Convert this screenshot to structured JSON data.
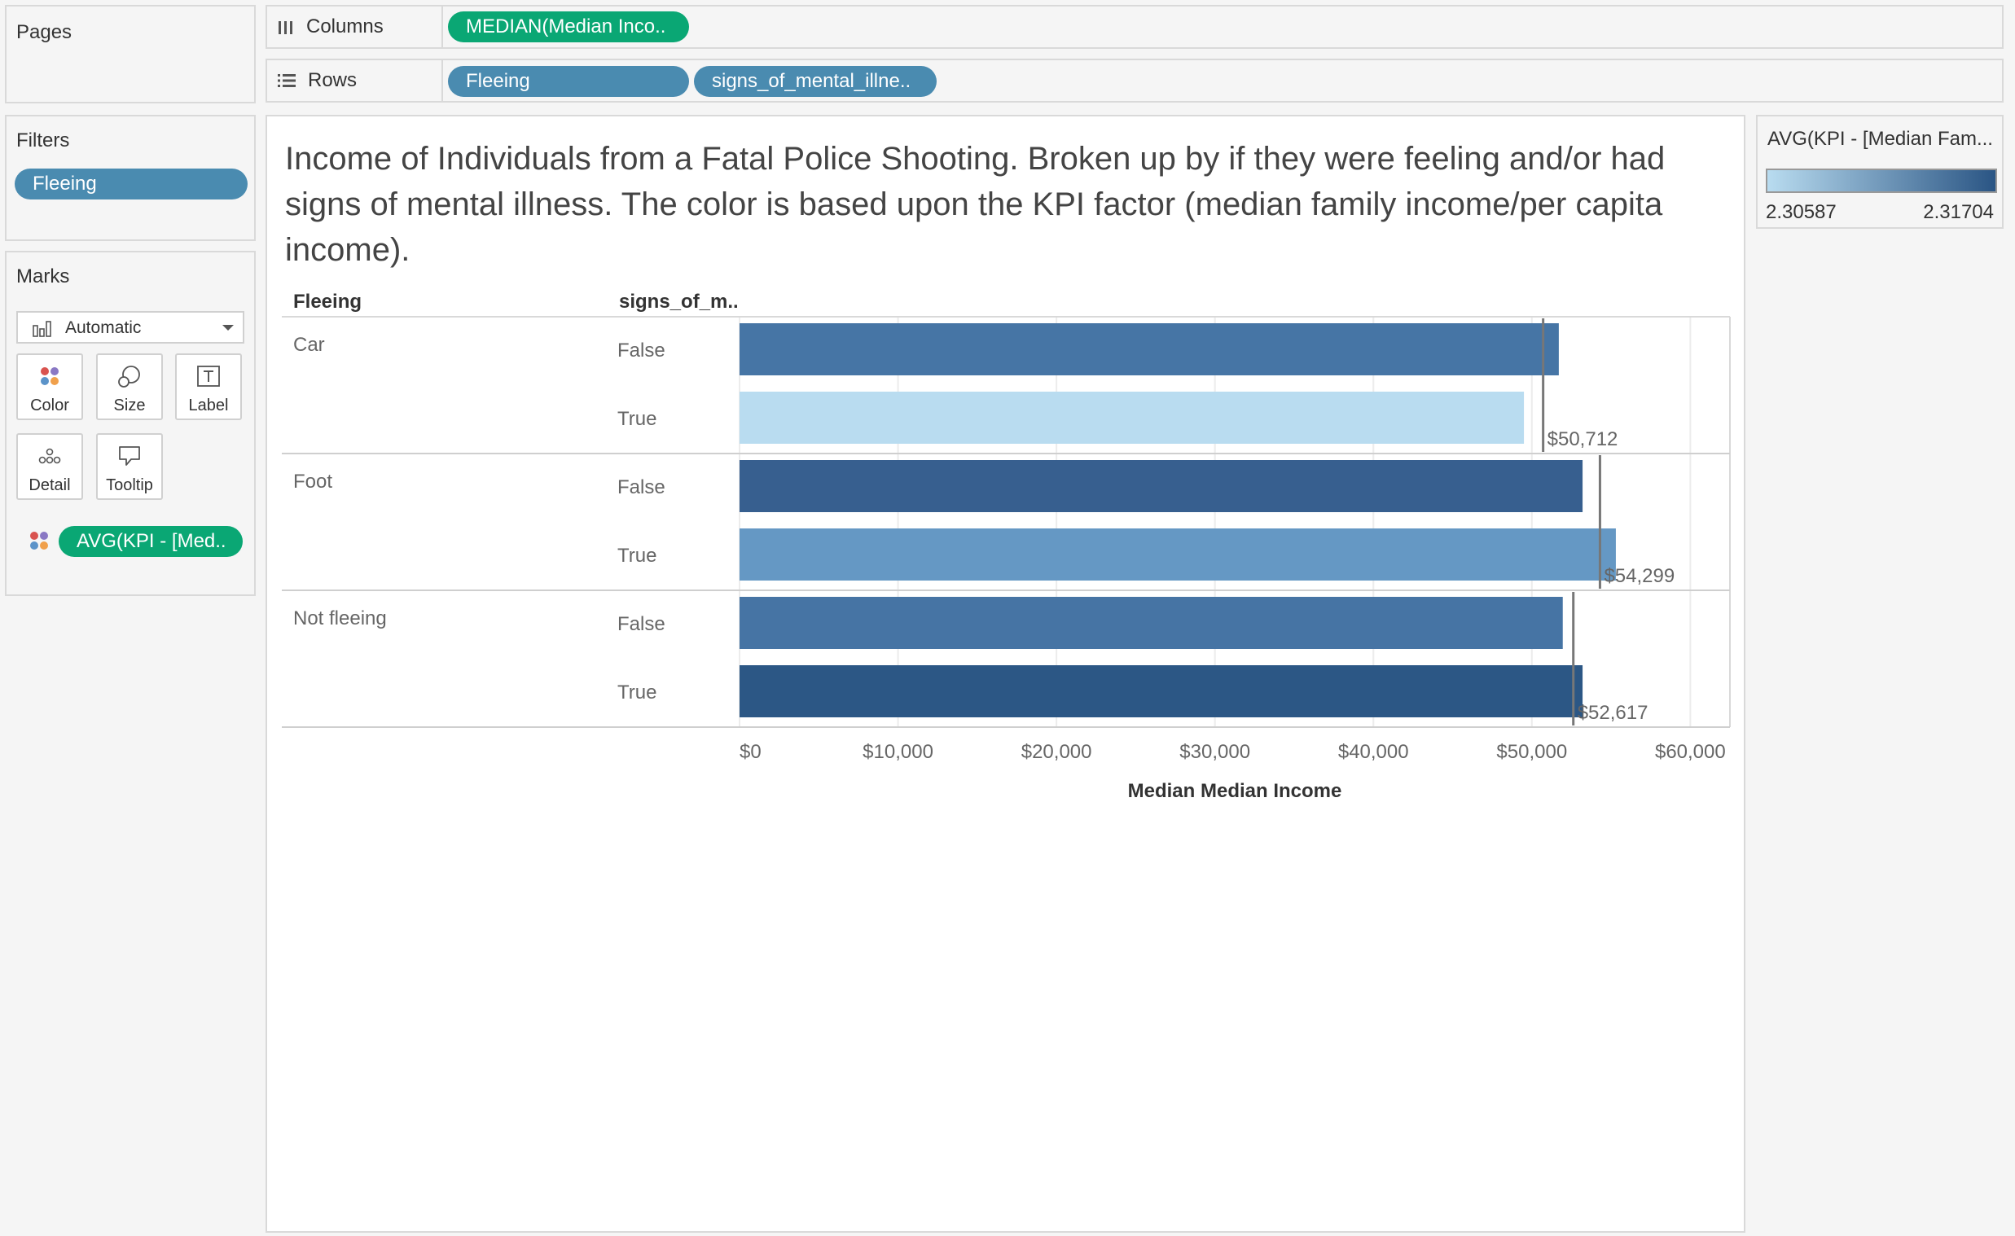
{
  "pages_panel": {
    "title": "Pages"
  },
  "columns_shelf": {
    "label": "Columns",
    "pills": [
      "MEDIAN(Median Inco.."
    ]
  },
  "rows_shelf": {
    "label": "Rows",
    "pills": [
      "Fleeing",
      "signs_of_mental_illne.."
    ]
  },
  "filters_panel": {
    "title": "Filters",
    "pills": [
      "Fleeing"
    ]
  },
  "marks_panel": {
    "title": "Marks",
    "mark_type": "Automatic",
    "buttons": [
      {
        "label": "Color",
        "icon": "color-dots-icon"
      },
      {
        "label": "Size",
        "icon": "size-bubbles-icon"
      },
      {
        "label": "Label",
        "icon": "label-text-icon"
      },
      {
        "label": "Detail",
        "icon": "detail-dots-icon"
      },
      {
        "label": "Tooltip",
        "icon": "tooltip-bubble-icon"
      }
    ],
    "field_pill": "AVG(KPI - [Med.."
  },
  "legend": {
    "title": "AVG(KPI - [Median Fam...",
    "min": "2.30587",
    "max": "2.31704",
    "color_low": "#b9dcf0",
    "color_high": "#2a5584"
  },
  "colors": {
    "shelf_green": "#0aa774",
    "shelf_blue": "#4a8bb0"
  },
  "chart_data": {
    "type": "bar",
    "orientation": "horizontal",
    "title": "Income of Individuals from a Fatal Police Shooting. Broken up by if they were feeling and/or had signs of mental illness. The color is based upon the KPI factor (median family income/per capita income).",
    "row_headers": [
      "Fleeing",
      "signs_of_m.."
    ],
    "xlabel": "Median Median Income",
    "xlim": [
      0,
      62500
    ],
    "xticks": [
      "$0",
      "$10,000",
      "$20,000",
      "$30,000",
      "$40,000",
      "$50,000",
      "$60,000"
    ],
    "xtick_values": [
      0,
      10000,
      20000,
      30000,
      40000,
      50000,
      60000
    ],
    "groups": [
      {
        "name": "Car",
        "bars": [
          {
            "category": "False",
            "value": 51700,
            "color": "#4675a5"
          },
          {
            "category": "True",
            "value": 49500,
            "color": "#b9dcf0"
          }
        ],
        "reference_line": 50712,
        "reference_label": "$50,712"
      },
      {
        "name": "Foot",
        "bars": [
          {
            "category": "False",
            "value": 53200,
            "color": "#375f8f"
          },
          {
            "category": "True",
            "value": 55300,
            "color": "#6598c4"
          }
        ],
        "reference_line": 54299,
        "reference_label": "$54,299"
      },
      {
        "name": "Not fleeing",
        "bars": [
          {
            "category": "False",
            "value": 51950,
            "color": "#4674a4"
          },
          {
            "category": "True",
            "value": 53200,
            "color": "#2c5785"
          }
        ],
        "reference_line": 52617,
        "reference_label": "$52,617"
      }
    ],
    "grid": true
  }
}
